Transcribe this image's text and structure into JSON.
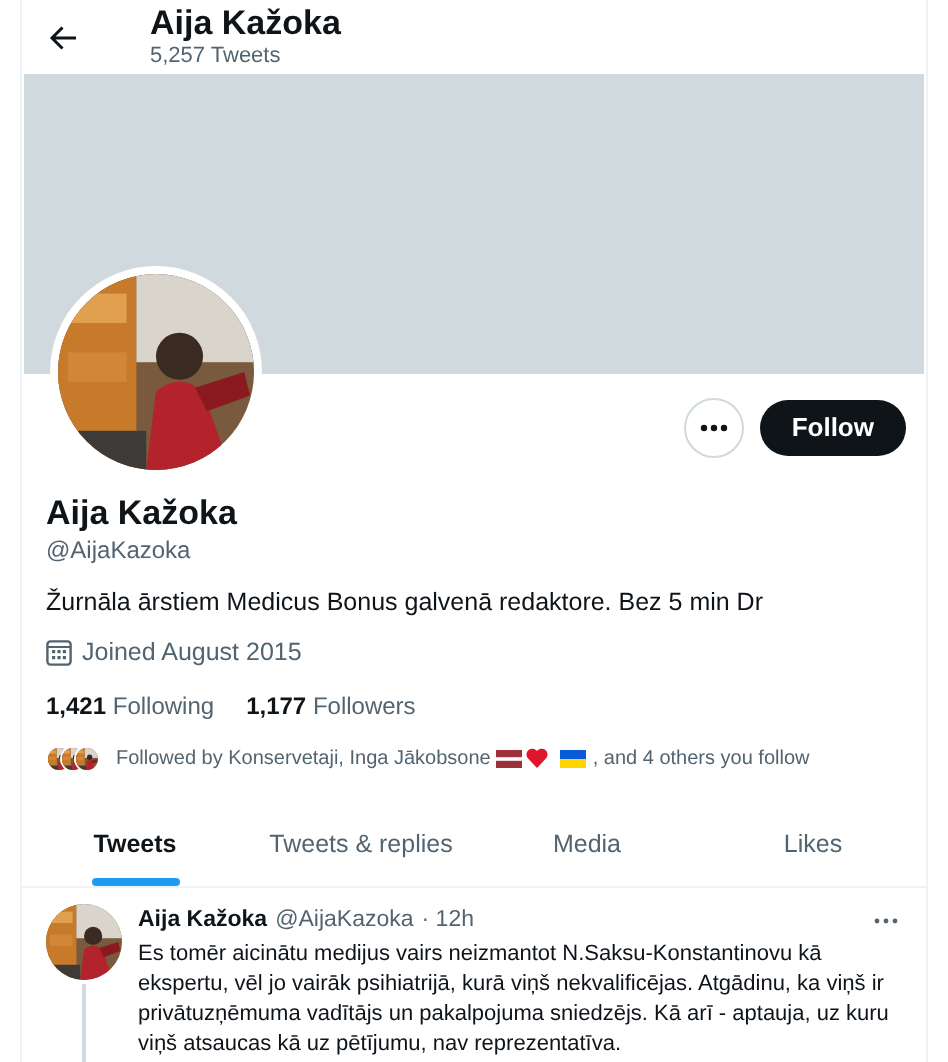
{
  "header": {
    "title": "Aija Kažoka",
    "subtitle": "5,257 Tweets"
  },
  "profile": {
    "actions": {
      "follow": "Follow"
    },
    "name": "Aija Kažoka",
    "handle": "@AijaKazoka",
    "bio": "Žurnāla ārstiem Medicus Bonus galvenā redaktore. Bez 5 min Dr",
    "joined": "Joined August 2015",
    "stats": [
      {
        "count": "1,421",
        "label": "Following"
      },
      {
        "count": "1,177",
        "label": "Followers"
      }
    ],
    "followed_by": {
      "text_before": "Followed by Konservetaji, Inga Jākobsone",
      "text_after": ", and 4 others you follow"
    }
  },
  "tabs": [
    {
      "label": "Tweets",
      "selected": true
    },
    {
      "label": "Tweets & replies",
      "selected": false
    },
    {
      "label": "Media",
      "selected": false
    },
    {
      "label": "Likes",
      "selected": false
    }
  ],
  "tweets": [
    {
      "name": "Aija Kažoka",
      "handle": "@AijaKazoka",
      "time": "· 12h",
      "text": "Es tomēr aicinātu medijus vairs neizmantot N.Saksu-Konstantinovu kā ekspertu, vēl jo vairāk psihiatrijā, kurā viņš nekvalificējas. Atgādinu, ka viņš ir privātuzņēmuma vadītājs un pakalpojuma sniedzējs. Kā arī - aptauja, uz kuru viņš atsaucas kā uz pētījumu, nav reprezentatīva.",
      "thread": true
    }
  ]
}
